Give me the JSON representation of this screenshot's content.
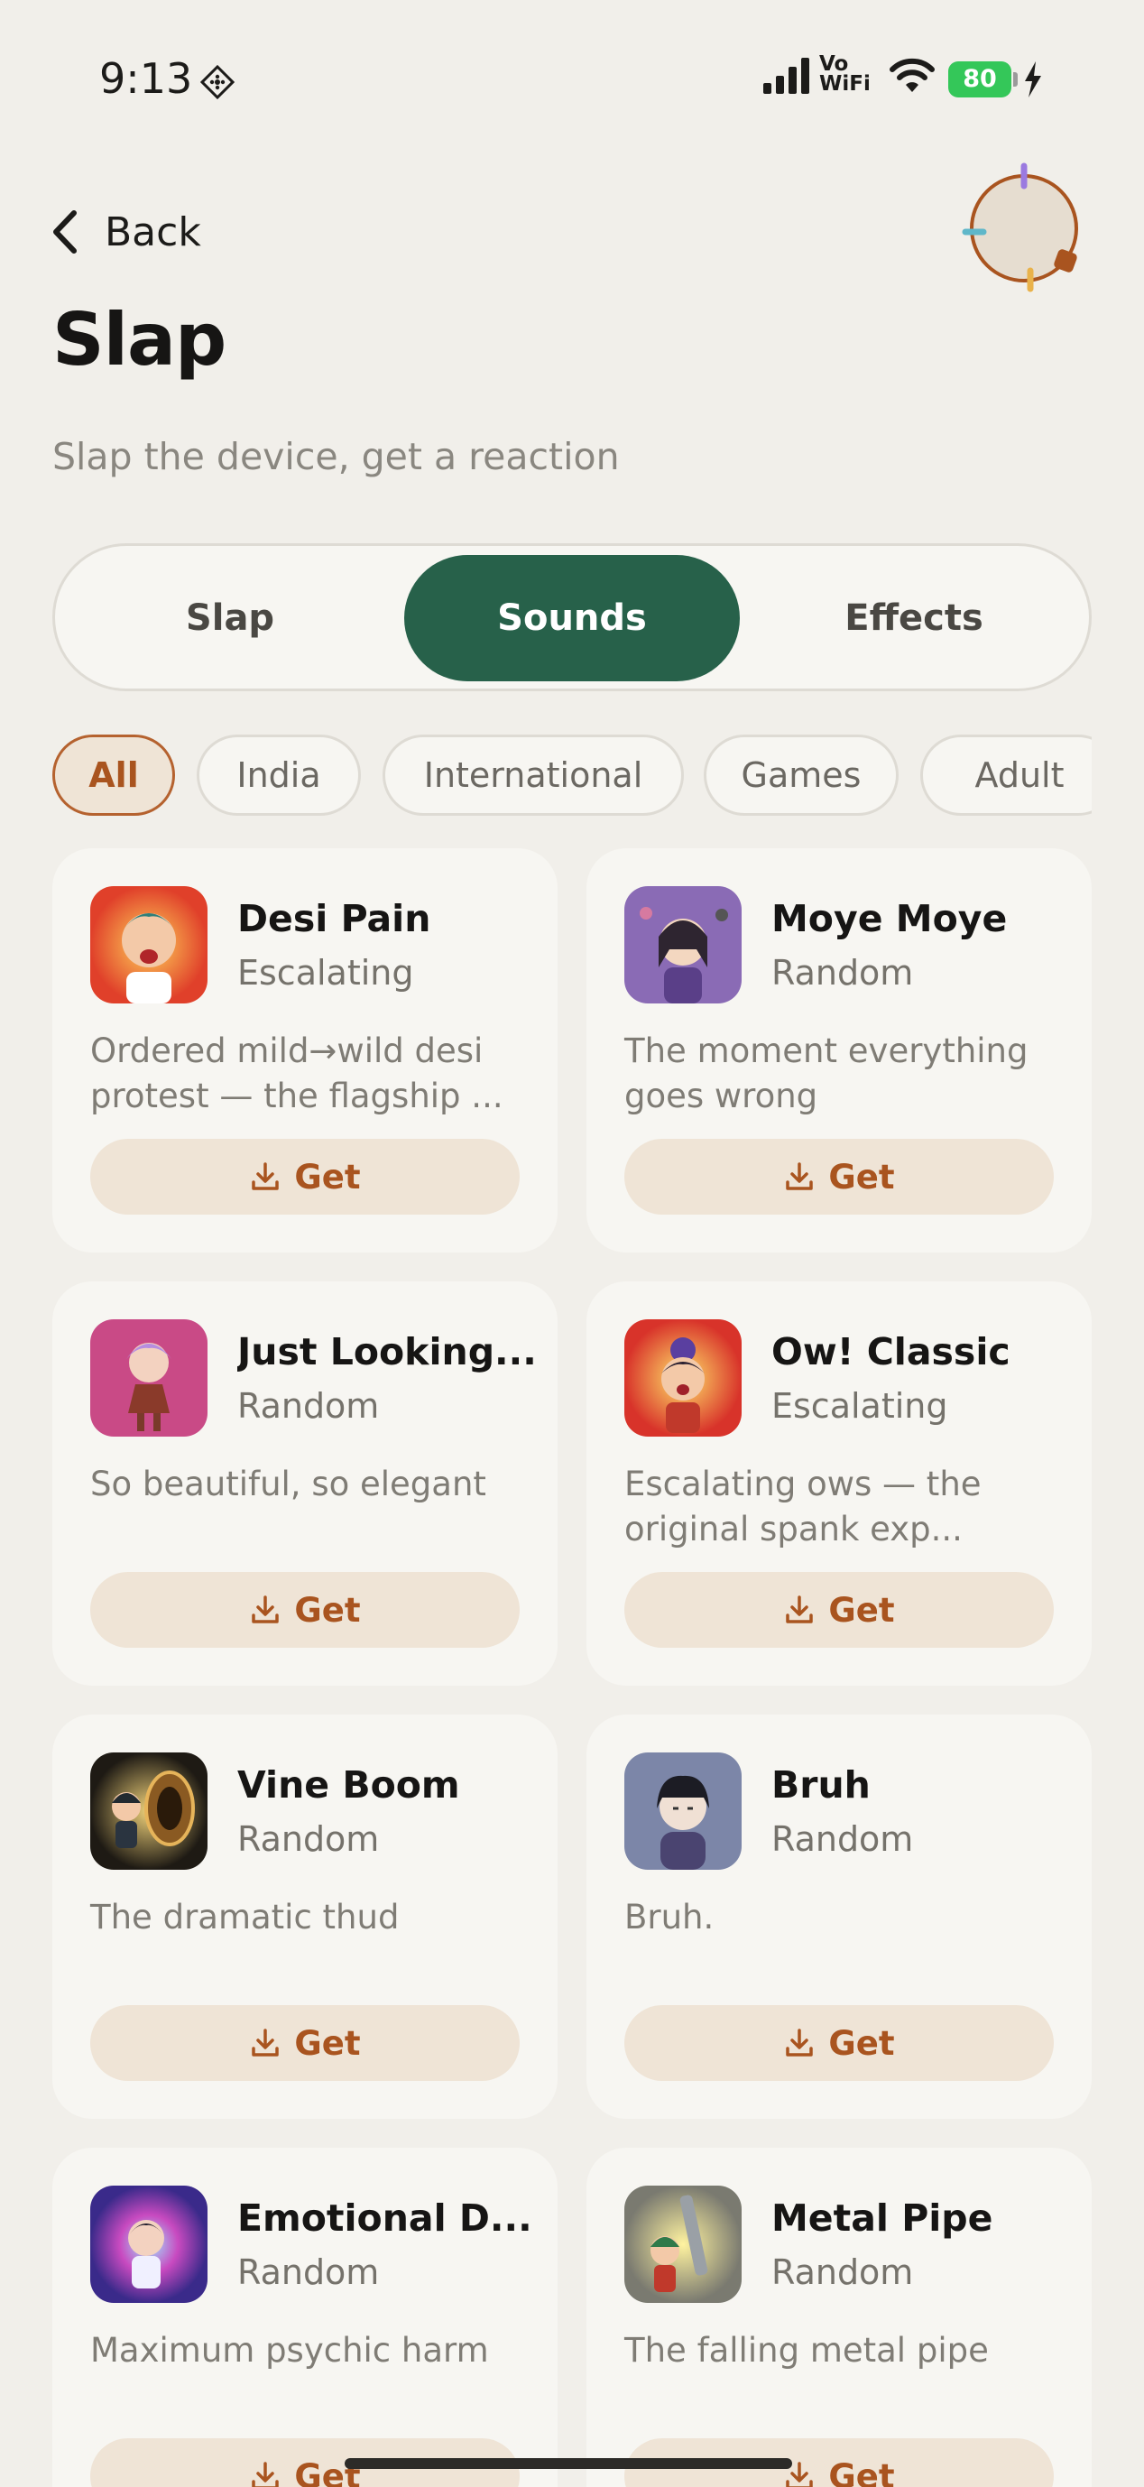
{
  "status_bar": {
    "time": "9:13",
    "network_label_top": "Vo",
    "network_label_bottom": "WiFi",
    "battery": "80"
  },
  "header": {
    "back_label": "Back",
    "title": "Slap",
    "subtitle": "Slap the device, get a reaction"
  },
  "tabs": [
    {
      "label": "Slap",
      "active": false
    },
    {
      "label": "Sounds",
      "active": true
    },
    {
      "label": "Effects",
      "active": false
    }
  ],
  "filters": [
    {
      "label": "All",
      "active": true
    },
    {
      "label": "India",
      "active": false
    },
    {
      "label": "International",
      "active": false
    },
    {
      "label": "Games",
      "active": false
    },
    {
      "label": "Adult",
      "active": false
    }
  ],
  "get_label": "Get",
  "sounds": [
    {
      "name": "Desi Pain",
      "mode": "Escalating",
      "description": "Ordered mild→wild desi protest — the flagship ..."
    },
    {
      "name": "Moye Moye",
      "mode": "Random",
      "description": "The moment everything goes wrong"
    },
    {
      "name": "Just Looking...",
      "mode": "Random",
      "description": "So beautiful, so elegant"
    },
    {
      "name": "Ow! Classic",
      "mode": "Escalating",
      "description": "Escalating ows — the original spank exp..."
    },
    {
      "name": "Vine Boom",
      "mode": "Random",
      "description": "The dramatic thud"
    },
    {
      "name": "Bruh",
      "mode": "Random",
      "description": "Bruh."
    },
    {
      "name": "Emotional D...",
      "mode": "Random",
      "description": "Maximum psychic harm"
    },
    {
      "name": "Metal Pipe",
      "mode": "Random",
      "description": "The falling metal pipe"
    }
  ],
  "colors": {
    "background": "#f1efea",
    "card": "#f7f6f2",
    "accent_green": "#27614a",
    "accent_orange": "#a9541f",
    "get_button_bg": "#efe4d6"
  }
}
